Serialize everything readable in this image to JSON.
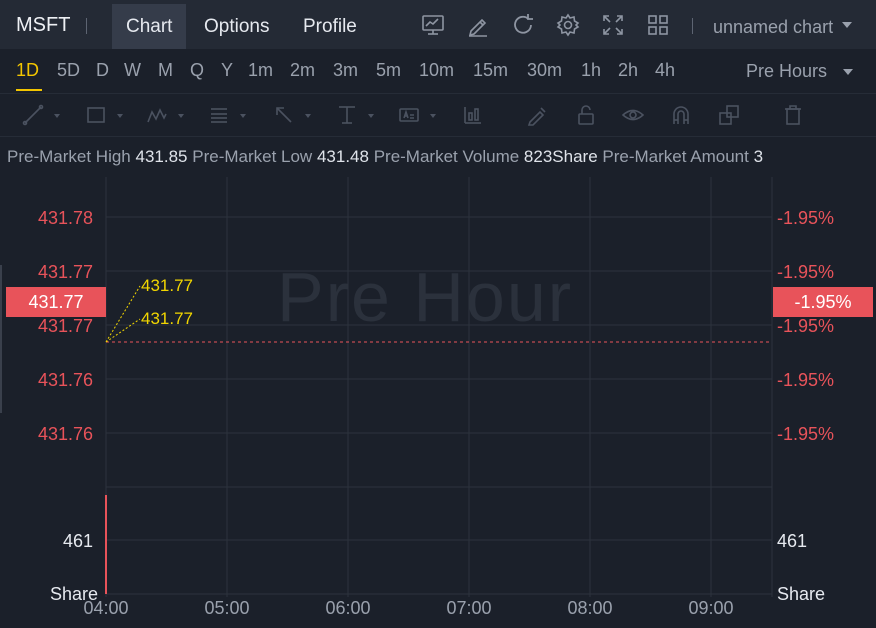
{
  "header": {
    "symbol": "MSFT",
    "tabs": [
      {
        "label": "Chart",
        "active": true
      },
      {
        "label": "Options",
        "active": false
      },
      {
        "label": "Profile",
        "active": false
      }
    ],
    "icons": [
      "indicator-chart-icon",
      "draw-pen-icon",
      "refresh-icon",
      "settings-gear-icon",
      "fullscreen-icon",
      "layout-grid-icon"
    ],
    "chart_name": "unnamed chart"
  },
  "intervals": {
    "items": [
      "1D",
      "5D",
      "D",
      "W",
      "M",
      "Q",
      "Y",
      "1m",
      "2m",
      "3m",
      "5m",
      "10m",
      "15m",
      "30m",
      "1h",
      "2h",
      "4h"
    ],
    "active": "1D",
    "session": "Pre Hours"
  },
  "drawing_tools": [
    "trend-line-icon",
    "rectangle-icon",
    "pattern-icon",
    "fibonacci-icon",
    "arrow-icon",
    "text-marker-icon",
    "annotation-icon",
    "signal-icon",
    "brush-icon",
    "lock-icon",
    "eye-icon",
    "magnet-icon",
    "layers-icon",
    "trash-icon"
  ],
  "info": {
    "high_label": "Pre-Market High",
    "high_value": "431.85",
    "low_label": "Pre-Market Low",
    "low_value": "431.48",
    "volume_label": "Pre-Market Volume",
    "volume_value": "823Share",
    "amount_label": "Pre-Market Amount",
    "amount_value": "3"
  },
  "chart": {
    "watermark": "Pre Hour",
    "price_ticks": [
      "431.78",
      "431.77",
      "431.77",
      "431.76",
      "431.76"
    ],
    "pct_ticks": [
      "-1.95%",
      "-1.95%",
      "-1.95%",
      "-1.95%",
      "-1.95%"
    ],
    "current_price": "431.77",
    "current_pct": "-1.95%",
    "callout_high": "431.77",
    "callout_low": "431.77",
    "volume_tick": "461",
    "volume_unit": "Share",
    "time_ticks": [
      "04:00",
      "05:00",
      "06:00",
      "07:00",
      "08:00",
      "09:00"
    ],
    "colors": {
      "down": "#e8535a",
      "accent": "#f2c500",
      "grid": "#2c323d"
    }
  },
  "chart_data": {
    "type": "line",
    "x": [
      "04:00",
      "05:00",
      "06:00",
      "07:00",
      "08:00",
      "09:00"
    ],
    "series": [
      {
        "values": [
          431.77
        ]
      }
    ],
    "ylim": [
      431.755,
      431.785
    ],
    "volume": [
      461
    ],
    "grid": true
  }
}
